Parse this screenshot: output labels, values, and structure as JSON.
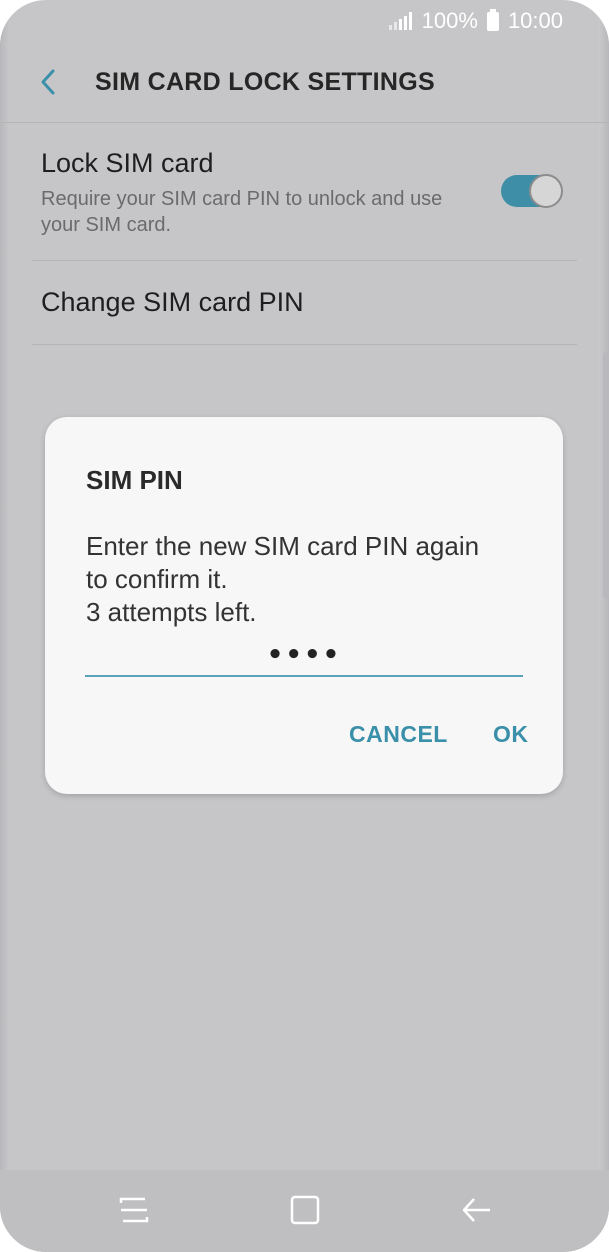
{
  "status_bar": {
    "battery_percent": "100%",
    "time": "10:00"
  },
  "app_bar": {
    "title": "SIM CARD LOCK SETTINGS",
    "back_icon": "chevron-left-icon"
  },
  "settings": {
    "lock_sim": {
      "title": "Lock SIM card",
      "description": "Require your SIM card PIN to unlock and use your SIM card.",
      "toggle_on": true
    },
    "change_pin": {
      "title": "Change SIM card PIN"
    }
  },
  "dialog": {
    "title": "SIM PIN",
    "message_line1": "Enter the new SIM card PIN again",
    "message_line2": "to confirm it.",
    "message_line3": "3 attempts left.",
    "pin_value": "••••",
    "cancel_label": "CANCEL",
    "ok_label": "OK"
  },
  "nav_bar": {
    "recent_icon": "recent-apps-icon",
    "home_icon": "home-icon",
    "back_icon": "back-arrow-icon"
  },
  "colors": {
    "accent": "#3a8fa9",
    "toggle_track": "#3e8ea8",
    "background": "#c6c6c8",
    "dialog_background": "#f7f7f7"
  }
}
